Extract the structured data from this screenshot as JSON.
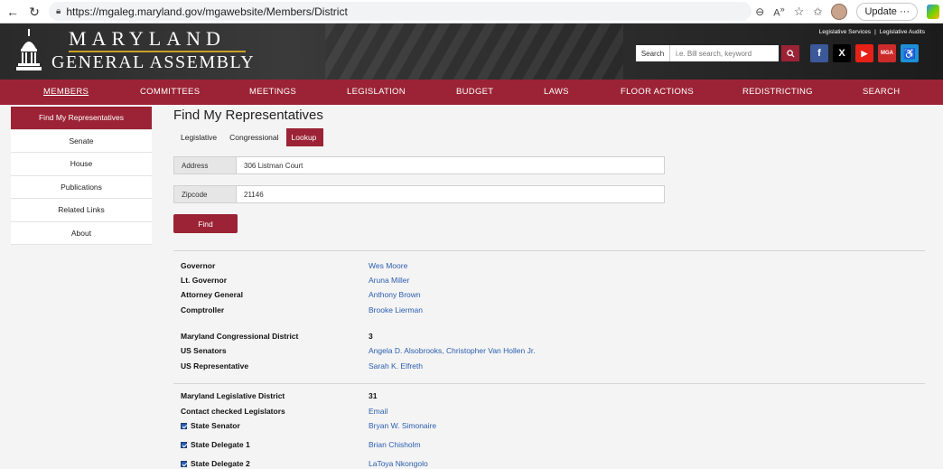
{
  "browser": {
    "url": "https://mgaleg.maryland.gov/mgawebsite/Members/District",
    "update_label": "Update",
    "more_label": "···"
  },
  "header": {
    "line1": "MARYLAND",
    "line2": "GENERAL ASSEMBLY",
    "toplinks": [
      "Legislative Services",
      "|",
      "Legislative Audits"
    ],
    "search_label": "Search",
    "search_placeholder": "i.e. Bill search, keyword",
    "social": [
      {
        "name": "facebook-icon",
        "glyph": "f",
        "color": "#3b5998"
      },
      {
        "name": "x-icon",
        "glyph": "X",
        "color": "#000000"
      },
      {
        "name": "youtube-icon",
        "glyph": "▶",
        "color": "#e62117"
      },
      {
        "name": "my-mga-icon",
        "glyph": "MGA",
        "color": "#cc2b2b"
      },
      {
        "name": "accessibility-icon",
        "glyph": "♿",
        "color": "#1e8fd6"
      }
    ]
  },
  "nav": {
    "items": [
      "MEMBERS",
      "COMMITTEES",
      "MEETINGS",
      "LEGISLATION",
      "BUDGET",
      "LAWS",
      "FLOOR ACTIONS",
      "REDISTRICTING",
      "SEARCH"
    ]
  },
  "sidebar": {
    "items": [
      "Find My Representatives",
      "Senate",
      "House",
      "Publications",
      "Related Links",
      "About"
    ]
  },
  "main": {
    "title": "Find My Representatives",
    "tabs": [
      "Legislative",
      "Congressional",
      "Lookup"
    ],
    "address_label": "Address",
    "address_value": "306 Listman Court",
    "zipcode_label": "Zipcode",
    "zipcode_value": "21146",
    "find_label": "Find"
  },
  "results": {
    "state": [
      {
        "label": "Governor",
        "value": "Wes Moore"
      },
      {
        "label": "Lt. Governor",
        "value": "Aruna Miller"
      },
      {
        "label": "Attorney General",
        "value": "Anthony Brown"
      },
      {
        "label": "Comptroller",
        "value": "Brooke Lierman"
      }
    ],
    "federal": [
      {
        "label": "Maryland Congressional District",
        "value": "3"
      },
      {
        "label": "US Senators",
        "value": "Angela D. Alsobrooks, Christopher Van Hollen Jr."
      },
      {
        "label": "US Representative",
        "value": "Sarah K. Elfreth"
      }
    ],
    "legislative": [
      {
        "label": "Maryland Legislative District",
        "value": "31"
      },
      {
        "label": "Contact checked Legislators",
        "value": "Email"
      },
      {
        "label": "State Senator",
        "value": "Bryan W. Simonaire"
      },
      {
        "label": "State Delegate 1",
        "value": "Brian Chisholm"
      },
      {
        "label": "State Delegate 2",
        "value": "LaToya Nkongolo"
      }
    ]
  }
}
